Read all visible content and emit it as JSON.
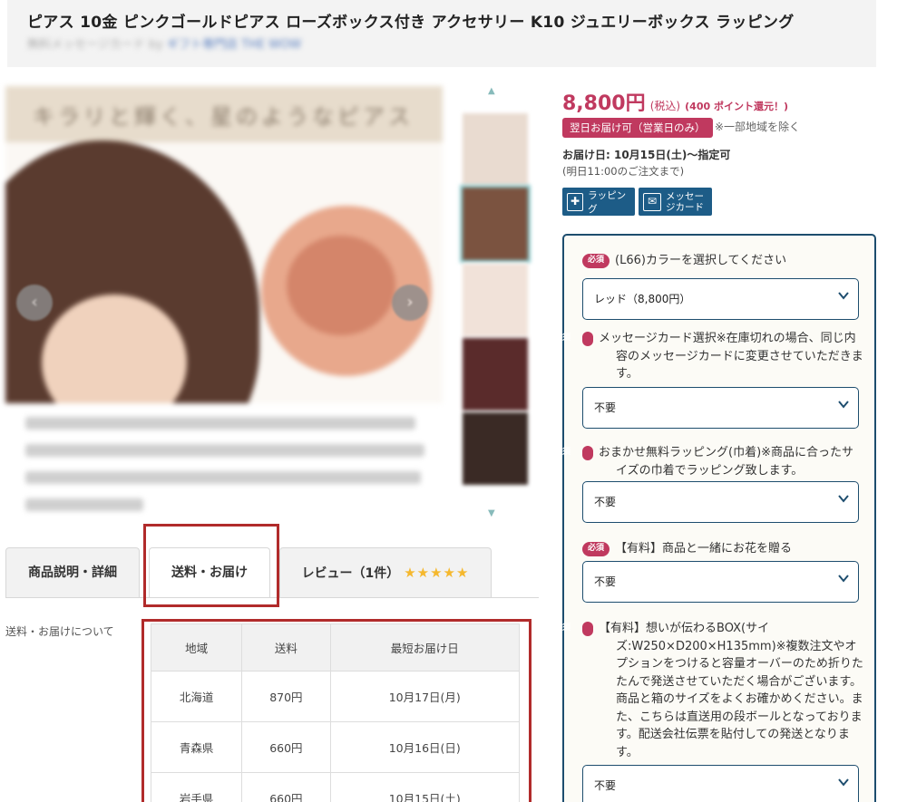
{
  "product": {
    "title": "ピアス 10金 ピンクゴールドピアス ローズボックス付き アクセサリー K10 ジュエリーボックス ラッピング",
    "subtitle": "無料メッセージカード by",
    "shop": "ギフト専門店 THE WOW"
  },
  "gallery": {
    "banner_text": "キラリと輝く、星のようなピアス",
    "prev_icon": "‹",
    "next_icon": "›",
    "thumb_up_icon": "▲",
    "thumb_down_icon": "▼"
  },
  "tabs": [
    {
      "label": "商品説明・詳細"
    },
    {
      "label": "送料・お届け"
    },
    {
      "label": "レビュー（1件）"
    }
  ],
  "review_stars": "★★★★★",
  "shipping": {
    "section_label": "送料・お届けについて",
    "headers": [
      "地域",
      "送料",
      "最短お届け日"
    ],
    "rows": [
      [
        "北海道",
        "870円",
        "10月17日(月)"
      ],
      [
        "青森県",
        "660円",
        "10月16日(日)"
      ],
      [
        "岩手県",
        "660円",
        "10月15日(土)"
      ]
    ]
  },
  "pricing": {
    "price": "8,800円",
    "tax": "(税込)",
    "points": "(400 ポイント還元！)",
    "next_day_badge": "翌日お届け可（営業日のみ）",
    "region_note": "※一部地域を除く",
    "delivery_date": "お届け日: 10月15日(土)〜指定可",
    "order_deadline": "(明日11:00のご注文まで)"
  },
  "services": {
    "wrapping": "ラッピング",
    "message_card": "メッセージカード",
    "wrapping_icon": "✚",
    "card_icon": "✉"
  },
  "options": {
    "required_badge": "必須",
    "items": [
      {
        "label": "(L66)カラーを選択してください",
        "value": "レッド（8,800円）"
      },
      {
        "label": "メッセージカード選択※在庫切れの場合、同じ内容のメッセージカードに変更させていただきます。",
        "value": "不要"
      },
      {
        "label": "おまかせ無料ラッピング(巾着)※商品に合ったサイズの巾着でラッピング致します。",
        "value": "不要"
      },
      {
        "label": "【有料】商品と一緒にお花を贈る",
        "value": "不要"
      },
      {
        "label": "【有料】想いが伝わるBOX(サイズ:W250×D200×H135mm)※複数注文やオプションをつけると容量オーバーのため折りたたんで発送させていただく場合がございます。商品と箱のサイズをよくお確かめください。また、こちらは直送用の段ボールとなっております。配送会社伝票を貼付しての発送となります。",
        "value": "不要"
      }
    ]
  },
  "colors": {
    "accent": "#c0395f",
    "navy": "#1d4d6e",
    "highlight_red": "#b12b2b"
  }
}
